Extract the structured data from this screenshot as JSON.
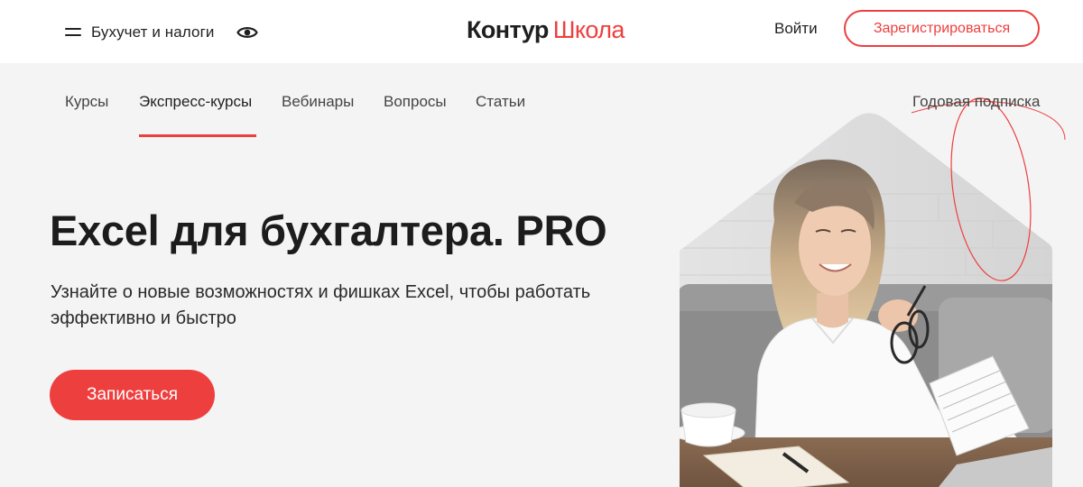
{
  "header": {
    "catalog_label": "Бухучет и налоги",
    "logo_primary": "Контур",
    "logo_secondary": "Школа",
    "login_label": "Войти",
    "register_label": "Зарегистрироваться"
  },
  "nav": {
    "items": [
      {
        "label": "Курсы",
        "active": false
      },
      {
        "label": "Экспресс-курсы",
        "active": true
      },
      {
        "label": "Вебинары",
        "active": false
      },
      {
        "label": "Вопросы",
        "active": false
      },
      {
        "label": "Статьи",
        "active": false
      }
    ],
    "subscription_label": "Годовая подписка"
  },
  "hero": {
    "title": "Excel для бухгалтера. PRO",
    "subtitle_line1": "Узнайте о новые возможностях и фишках Excel, чтобы работать",
    "subtitle_line2": "эффективно и быстро",
    "cta_label": "Записаться"
  },
  "icons": {
    "menu": "hamburger-icon",
    "accessibility": "eye-icon"
  },
  "colors": {
    "accent": "#ee3f3f",
    "text": "#1f1f1f",
    "page_background": "#f4f4f4",
    "header_background": "#ffffff"
  }
}
